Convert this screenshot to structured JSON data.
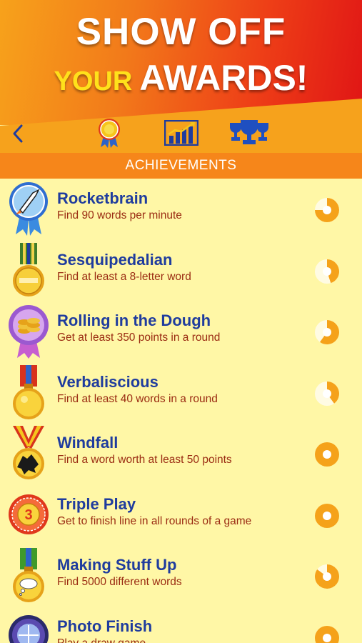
{
  "banner": {
    "line1": "SHOW OFF",
    "line2_a": "YOUR",
    "line2_b": "AWARDS!"
  },
  "toolbar": {
    "back_icon": "chevron-left-icon",
    "tabs": [
      {
        "icon": "medal-ribbon-icon"
      },
      {
        "icon": "bar-chart-icon"
      },
      {
        "icon": "trophies-icon"
      }
    ]
  },
  "section": {
    "title": "ACHIEVEMENTS"
  },
  "colors": {
    "title_blue": "#1f3c9e",
    "desc_red": "#9a2b12",
    "background": "#fff7a6",
    "progress_orange": "#f5a21a",
    "progress_light": "#fffbe3"
  },
  "achievements": [
    {
      "title": "Rocketbrain",
      "description": "Find 90 words per minute",
      "medal_icon": "rocket-medal-icon",
      "progress": 0.75
    },
    {
      "title": "Sesquipedalian",
      "description": "Find at least a 8-letter word",
      "medal_icon": "word-medallion-icon",
      "progress": 0.45
    },
    {
      "title": "Rolling in the Dough",
      "description": "Get at least 350 points in a round",
      "medal_icon": "coins-rosette-icon",
      "progress": 0.6
    },
    {
      "title": "Verbaliscious",
      "description": "Find at least 40 words in a round",
      "medal_icon": "gold-medal-icon",
      "progress": 0.4
    },
    {
      "title": "Windfall",
      "description": "Find a word worth at least 50 points",
      "medal_icon": "splatter-medal-icon",
      "progress": 1.0
    },
    {
      "title": "Triple Play",
      "description": "Get to finish line in all rounds of a game",
      "medal_icon": "three-rosette-icon",
      "progress": 1.0
    },
    {
      "title": "Making Stuff Up",
      "description": "Find 5000 different words",
      "medal_icon": "thought-medal-icon",
      "progress": 0.85
    },
    {
      "title": "Photo Finish",
      "description": "Play a draw game",
      "medal_icon": "photo-finish-icon",
      "progress": 1.0
    }
  ]
}
